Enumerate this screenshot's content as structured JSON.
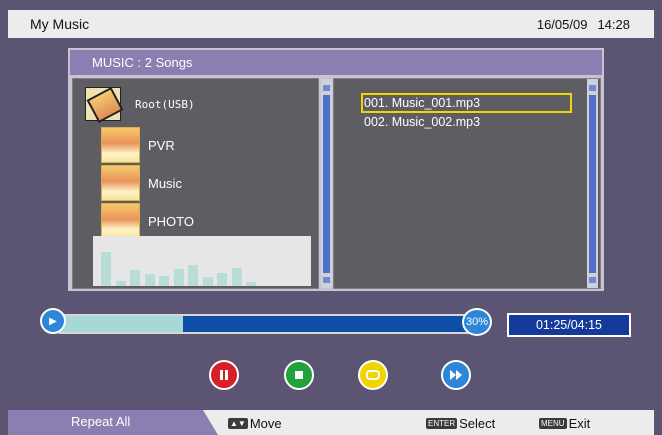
{
  "app_title": "My Music",
  "date": "16/05/09",
  "time": "14:28",
  "panel": {
    "title": "MUSIC : 2 Songs"
  },
  "folders": {
    "root": "Root(USB)",
    "items": [
      "PVR",
      "Music",
      "PHOTO"
    ]
  },
  "visualizer": {
    "levels": [
      0.68,
      0.1,
      0.32,
      0.24,
      0.2,
      0.34,
      0.42,
      0.18,
      0.26,
      0.36,
      0.08
    ]
  },
  "songs": [
    {
      "label": "001.  Music_001.mp3",
      "selected": true
    },
    {
      "label": "002.  Music_002.mp3",
      "selected": false
    }
  ],
  "playback": {
    "progress_percent": 30,
    "progress_label": "30%",
    "time_display": "01:25/04:15",
    "play_glyph": "▶"
  },
  "controls": [
    {
      "icon": "pause-icon",
      "color": "#d8202a"
    },
    {
      "icon": "stop-icon",
      "color": "#22a33a"
    },
    {
      "icon": "repeat-icon",
      "color": "#f2d500"
    },
    {
      "icon": "fast-forward-icon",
      "color": "#2e86d8"
    }
  ],
  "footer": {
    "repeat_mode": "Repeat All",
    "move_key": "▲▼",
    "move_label": "Move",
    "enter_key": "ENTER",
    "select_label": "Select",
    "menu_key": "MENU",
    "exit_label": "Exit"
  },
  "colors": {
    "background": "#5b5472",
    "accent": "#8a7fb0",
    "selection": "#f1d600",
    "progress": "#0e4ea8"
  }
}
